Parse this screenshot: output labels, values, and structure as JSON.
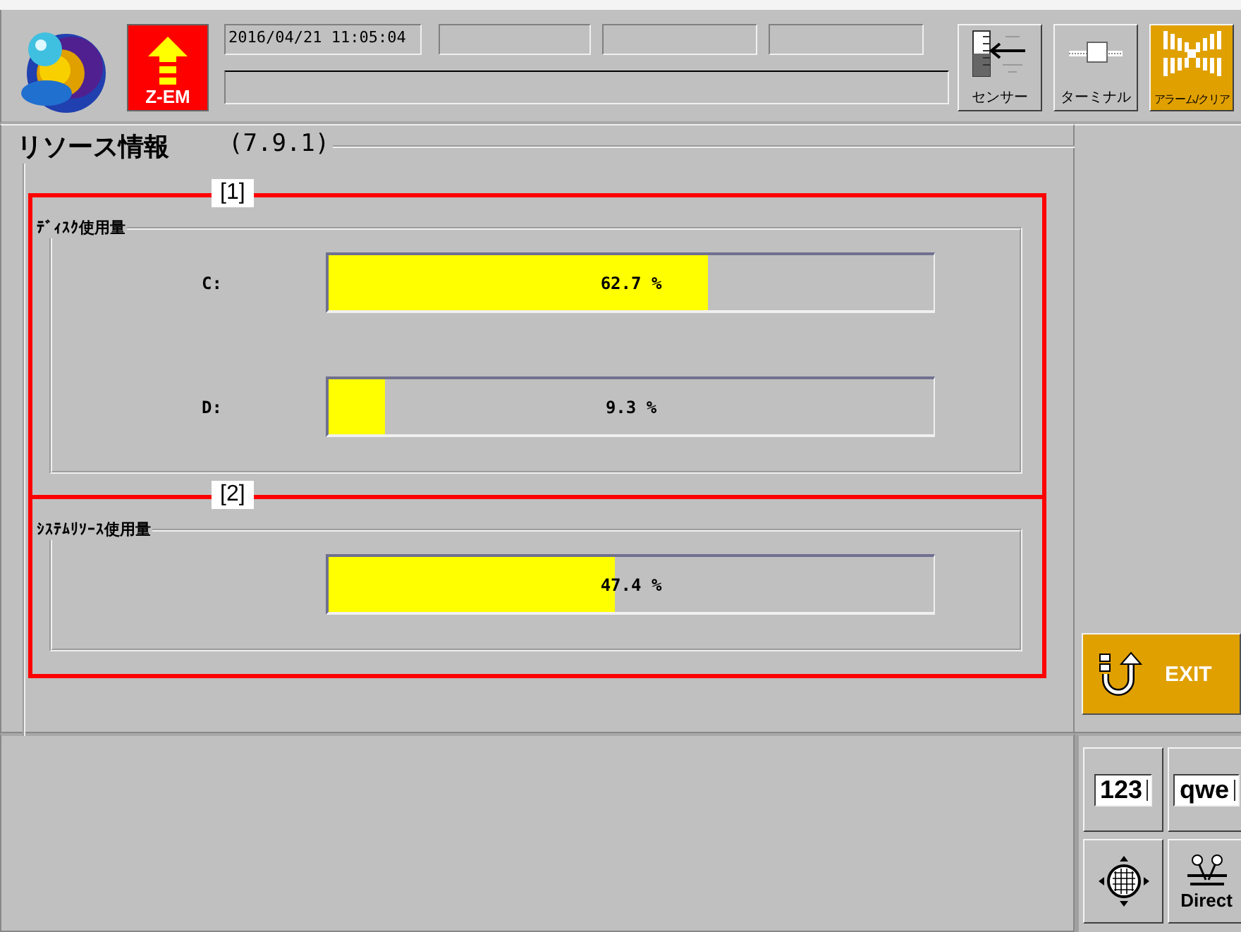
{
  "header": {
    "logo_badge": "Z-EM",
    "datetime": "2016/04/21 11:05:04",
    "buttons": [
      {
        "kind": "sensor",
        "label": "センサー",
        "active": false
      },
      {
        "kind": "terminal",
        "label": "ターミナル",
        "active": false
      },
      {
        "kind": "alarm",
        "label": "アラーム/クリア",
        "active": true
      }
    ]
  },
  "section": {
    "title": "リソース情報",
    "code": "(7.9.1)"
  },
  "groups": [
    {
      "marker": "[1]",
      "title": "ﾃﾞｨｽｸ使用量",
      "meters": [
        {
          "label": "C:",
          "level": 0.627,
          "reading": "62.7 %"
        },
        {
          "label": "D:",
          "level": 0.093,
          "reading": "9.3 %"
        }
      ]
    },
    {
      "marker": "[2]",
      "title": "ｼｽﾃﾑﾘｿｰｽ使用量",
      "meters": [
        {
          "level": 0.474,
          "reading": "47.4 %"
        }
      ]
    }
  ],
  "exit_button": {
    "label": "EXIT"
  },
  "keypad": [
    {
      "kind": "numeric",
      "label": "123"
    },
    {
      "kind": "alpha",
      "label": "qwe"
    },
    {
      "kind": "cursor"
    },
    {
      "kind": "direct",
      "label": "Direct"
    }
  ]
}
